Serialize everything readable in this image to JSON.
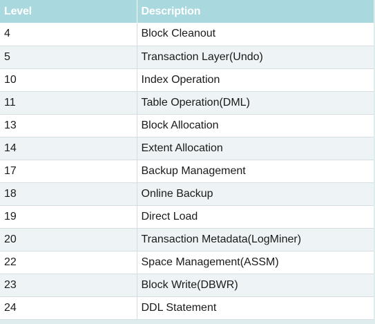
{
  "table": {
    "headers": [
      "Level",
      "Description"
    ],
    "rows": [
      {
        "level": "4",
        "description": "Block Cleanout"
      },
      {
        "level": "5",
        "description": "Transaction Layer(Undo)"
      },
      {
        "level": "10",
        "description": "Index Operation"
      },
      {
        "level": "11",
        "description": "Table Operation(DML)"
      },
      {
        "level": "13",
        "description": "Block Allocation"
      },
      {
        "level": "14",
        "description": "Extent Allocation"
      },
      {
        "level": "17",
        "description": "Backup Management"
      },
      {
        "level": "18",
        "description": "Online Backup"
      },
      {
        "level": "19",
        "description": "Direct Load"
      },
      {
        "level": "20",
        "description": "Transaction Metadata(LogMiner)"
      },
      {
        "level": "22",
        "description": "Space Management(ASSM)"
      },
      {
        "level": "23",
        "description": "Block Write(DBWR)"
      },
      {
        "level": "24",
        "description": "DDL Statement"
      }
    ]
  },
  "colors": {
    "header_bg": "#a9d8de",
    "header_text": "#ffffff",
    "row_alt": "#eef4f5"
  }
}
